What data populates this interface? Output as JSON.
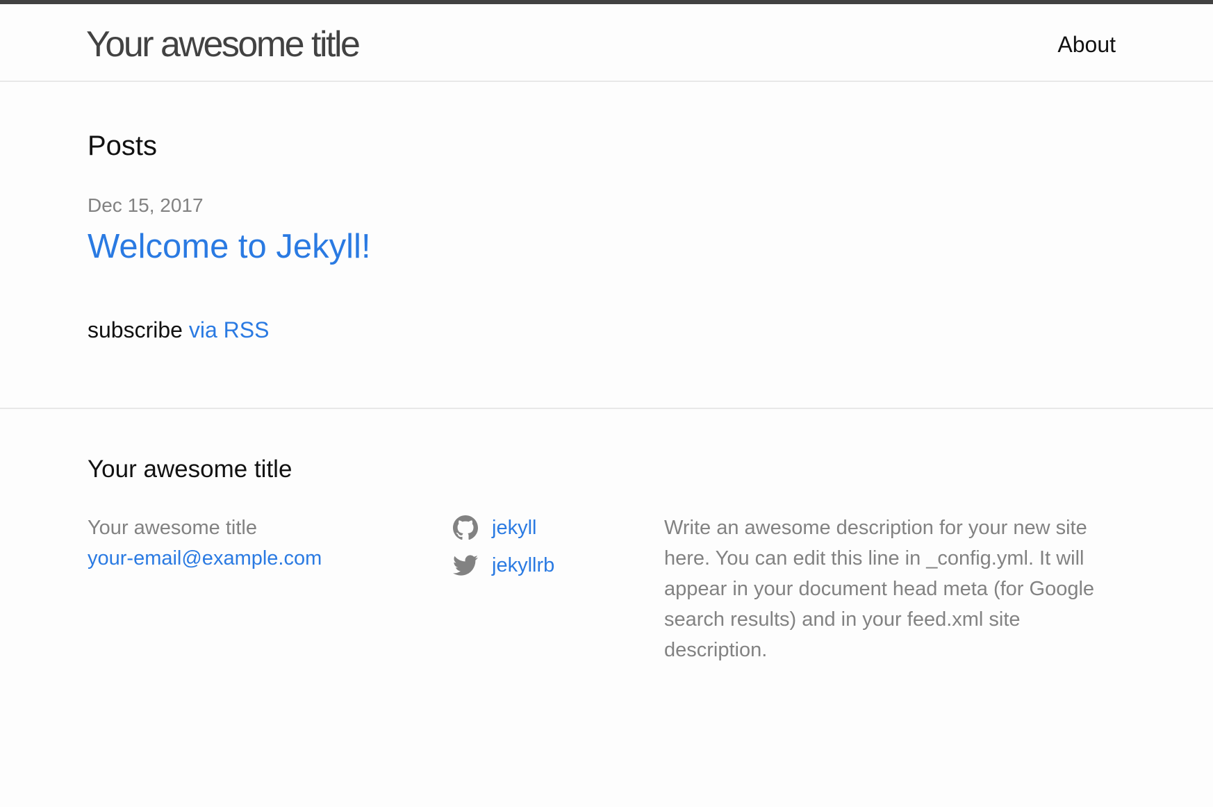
{
  "header": {
    "site_title": "Your awesome title",
    "nav": [
      {
        "label": "About"
      }
    ]
  },
  "main": {
    "heading": "Posts",
    "posts": [
      {
        "date": "Dec 15, 2017",
        "title": "Welcome to Jekyll!"
      }
    ],
    "rss": {
      "prefix": "subscribe",
      "link_label": "via RSS"
    }
  },
  "footer": {
    "heading": "Your awesome title",
    "contact": {
      "name": "Your awesome title",
      "email": "your-email@example.com"
    },
    "social": [
      {
        "icon": "github-icon",
        "label": "jekyll"
      },
      {
        "icon": "twitter-icon",
        "label": "jekyllrb"
      }
    ],
    "description": "Write an awesome description for your new site here. You can edit this line in _config.yml. It will appear in your document head meta (for Google search results) and in your feed.xml site description."
  },
  "colors": {
    "link": "#2a7ae2",
    "text": "#111111",
    "muted": "#828282",
    "title": "#424242",
    "background": "#fdfdfd",
    "border": "#e8e8e8",
    "top_bar": "#424242"
  }
}
